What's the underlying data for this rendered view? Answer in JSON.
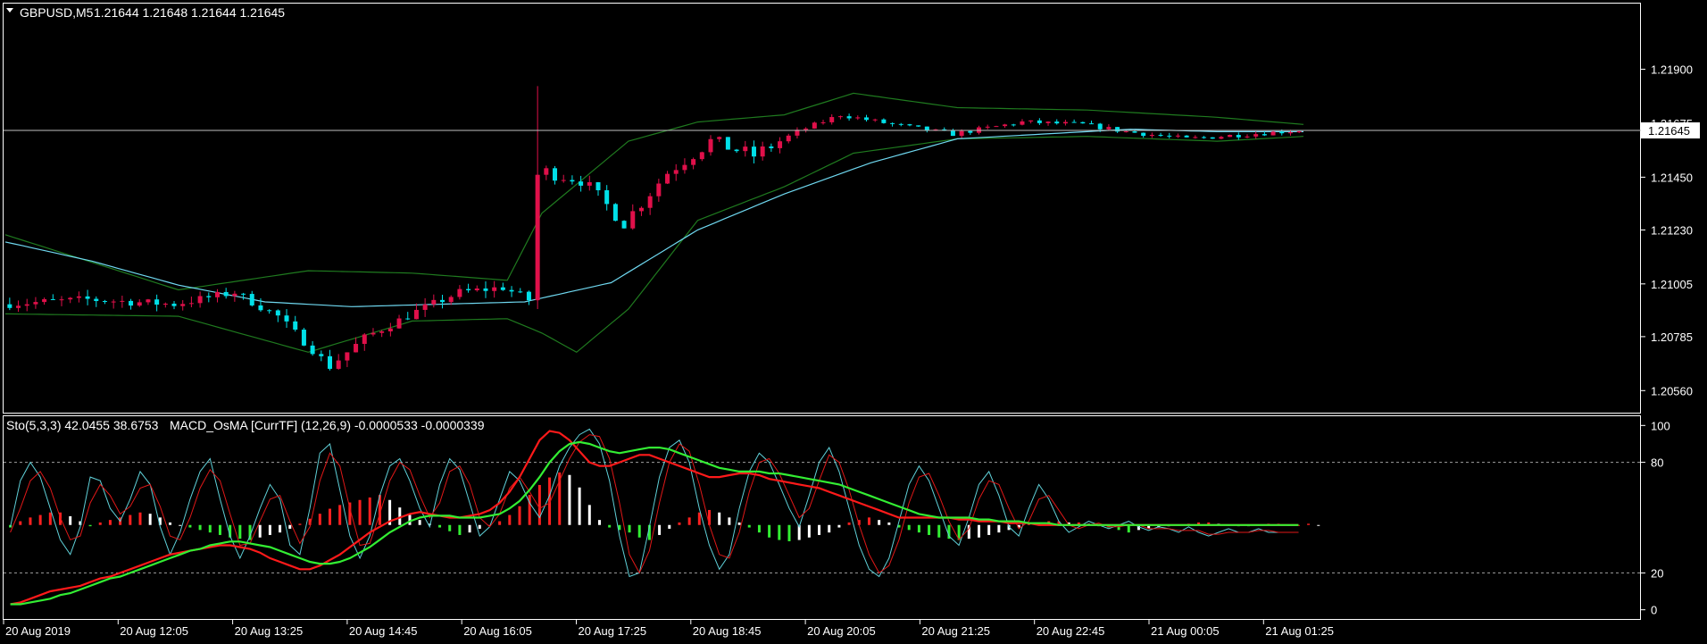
{
  "header": {
    "symbol": "GBPUSD,M5",
    "quote": "1.21644 1.21648 1.21644 1.21645",
    "dropdown_icon": "triangle-down-icon"
  },
  "indicator_header": {
    "stochastic": "Sto(5,3,3) 42.0455 38.6753",
    "macd": "MACD_OsMA [CurrTF] (12,26,9) -0.0000533 -0.0000339"
  },
  "colors": {
    "background": "#000000",
    "border": "#ffffff",
    "bull_candle": "#00e0e8",
    "bear_candle": "#e0104a",
    "bollinger": "#1f7a1f",
    "moving_average": "#6fd8f0",
    "price_line": "#c0c0c0",
    "price_label_bg": "#ffffff",
    "stoch_main": "#5fd0d8",
    "stoch_signal": "#e01818",
    "macd_main": "#ff1a1a",
    "macd_signal": "#33ee33",
    "hist_up": "#ff2020",
    "hist_up_fade": "#ffffff",
    "hist_down": "#33ee33",
    "hist_down_fade": "#ffffff",
    "level_line": "#a0a0a0"
  },
  "chart_data": [
    {
      "type": "candlestick",
      "price_axis": {
        "ticks": [
          "1.21900",
          "1.21675",
          "1.21450",
          "1.21230",
          "1.21005",
          "1.20785",
          "1.20560"
        ],
        "tick_values": [
          1.219,
          1.21675,
          1.2145,
          1.2123,
          1.21005,
          1.20785,
          1.2056
        ],
        "ylim": [
          1.20468,
          1.22174
        ],
        "current_price": "1.21645",
        "current_value": 1.21645
      },
      "time_axis": {
        "labels": [
          "20 Aug 2019",
          "20 Aug 12:05",
          "20 Aug 13:25",
          "20 Aug 14:45",
          "20 Aug 16:05",
          "20 Aug 17:25",
          "20 Aug 18:45",
          "20 Aug 20:05",
          "20 Aug 21:25",
          "20 Aug 22:45",
          "21 Aug 00:05",
          "21 Aug 01:25"
        ]
      },
      "bar_count": 200,
      "price_path": [
        [
          0,
          1.2092
        ],
        [
          10,
          1.2094
        ],
        [
          20,
          1.2092
        ],
        [
          27,
          1.2097
        ],
        [
          32,
          1.2087
        ],
        [
          38,
          1.2066
        ],
        [
          42,
          1.2078
        ],
        [
          48,
          1.2089
        ],
        [
          53,
          1.2097
        ],
        [
          58,
          1.2099
        ],
        [
          61,
          1.2094
        ],
        [
          62,
          1.2148
        ],
        [
          67,
          1.2144
        ],
        [
          72,
          1.2126
        ],
        [
          77,
          1.2147
        ],
        [
          82,
          1.216
        ],
        [
          87,
          1.2154
        ],
        [
          92,
          1.2164
        ],
        [
          97,
          1.2171
        ],
        [
          103,
          1.2167
        ],
        [
          110,
          1.2163
        ],
        [
          118,
          1.2168
        ],
        [
          125,
          1.2167
        ],
        [
          130,
          1.2164
        ],
        [
          137,
          1.2161
        ],
        [
          150,
          1.21645
        ]
      ],
      "series": [
        {
          "name": "Bollinger upper",
          "points": [
            [
              0,
              1.2121
            ],
            [
              20,
              1.2098
            ],
            [
              35,
              1.2106
            ],
            [
              47,
              1.2105
            ],
            [
              58,
              1.2102
            ],
            [
              62,
              1.213
            ],
            [
              72,
              1.216
            ],
            [
              80,
              1.2168
            ],
            [
              90,
              1.2171
            ],
            [
              98,
              1.218
            ],
            [
              110,
              1.2174
            ],
            [
              125,
              1.2173
            ],
            [
              140,
              1.217
            ],
            [
              150,
              1.2167
            ]
          ]
        },
        {
          "name": "Bollinger lower",
          "points": [
            [
              0,
              1.2088
            ],
            [
              20,
              1.2087
            ],
            [
              35,
              1.2072
            ],
            [
              47,
              1.2085
            ],
            [
              58,
              1.2086
            ],
            [
              62,
              1.208
            ],
            [
              66,
              1.2072
            ],
            [
              72,
              1.209
            ],
            [
              80,
              1.2127
            ],
            [
              90,
              1.2141
            ],
            [
              98,
              1.2155
            ],
            [
              110,
              1.2161
            ],
            [
              125,
              1.2162
            ],
            [
              140,
              1.216
            ],
            [
              150,
              1.2162
            ]
          ]
        },
        {
          "name": "Moving average",
          "points": [
            [
              0,
              1.2118
            ],
            [
              10,
              1.211
            ],
            [
              20,
              1.21
            ],
            [
              30,
              1.2093
            ],
            [
              40,
              1.2091
            ],
            [
              50,
              1.2092
            ],
            [
              60,
              1.2093
            ],
            [
              70,
              1.2101
            ],
            [
              80,
              1.2123
            ],
            [
              90,
              1.2138
            ],
            [
              100,
              1.2151
            ],
            [
              110,
              1.2161
            ],
            [
              120,
              1.2163
            ],
            [
              130,
              1.2165
            ],
            [
              140,
              1.2164
            ],
            [
              150,
              1.2164
            ]
          ]
        }
      ]
    },
    {
      "type": "line",
      "title": "Sto(5,3,3) 42.0455 38.6753",
      "levels": [
        {
          "label": "100",
          "value": 100
        },
        {
          "label": "80",
          "value": 80
        },
        {
          "label": "20",
          "value": 20
        },
        {
          "label": "0",
          "value": 0
        }
      ],
      "ylim": [
        -5,
        105
      ],
      "series": [
        {
          "name": "Sto main",
          "values": [
            45,
            70,
            80,
            72,
            55,
            38,
            30,
            45,
            72,
            70,
            55,
            48,
            60,
            75,
            68,
            45,
            30,
            42,
            60,
            75,
            82,
            60,
            40,
            28,
            40,
            55,
            68,
            60,
            35,
            30,
            55,
            85,
            90,
            65,
            40,
            28,
            40,
            62,
            78,
            82,
            70,
            55,
            45,
            68,
            82,
            76,
            58,
            40,
            45,
            60,
            75,
            70,
            58,
            50,
            62,
            78,
            88,
            95,
            98,
            90,
            70,
            40,
            18,
            20,
            45,
            72,
            88,
            92,
            80,
            55,
            35,
            22,
            30,
            55,
            75,
            85,
            80,
            68,
            55,
            45,
            62,
            80,
            88,
            75,
            55,
            35,
            22,
            18,
            28,
            48,
            68,
            78,
            70,
            55,
            40,
            35,
            50,
            68,
            75,
            62,
            45,
            40,
            55,
            68,
            60,
            48,
            42,
            45,
            48,
            46,
            44,
            46,
            48,
            45,
            43,
            45,
            44,
            42,
            45,
            42,
            40,
            42,
            44,
            42,
            42,
            44,
            42,
            42,
            42,
            42
          ]
        },
        {
          "name": "Sto signal",
          "values": [
            42,
            55,
            70,
            75,
            66,
            50,
            38,
            40,
            58,
            68,
            62,
            52,
            56,
            66,
            68,
            56,
            40,
            38,
            50,
            66,
            76,
            70,
            52,
            35,
            36,
            48,
            60,
            62,
            48,
            36,
            45,
            70,
            85,
            78,
            55,
            35,
            36,
            52,
            70,
            80,
            76,
            62,
            50,
            58,
            75,
            78,
            68,
            50,
            45,
            52,
            66,
            72,
            64,
            55,
            58,
            70,
            82,
            91,
            95,
            94,
            82,
            58,
            30,
            20,
            32,
            58,
            80,
            90,
            86,
            68,
            46,
            30,
            28,
            42,
            64,
            80,
            82,
            74,
            62,
            50,
            55,
            70,
            84,
            80,
            65,
            46,
            30,
            20,
            24,
            38,
            58,
            72,
            74,
            62,
            48,
            38,
            44,
            60,
            70,
            68,
            55,
            44,
            48,
            60,
            62,
            54,
            46,
            44,
            46,
            47,
            45,
            45,
            46,
            46,
            44,
            44,
            44,
            43,
            43,
            43,
            41,
            41,
            42,
            42,
            42,
            43,
            43,
            42,
            42,
            42
          ]
        },
        {
          "name": "MACD main",
          "values": [
            3,
            4,
            6,
            8,
            10,
            11,
            12,
            13,
            15,
            17,
            18,
            20,
            22,
            24,
            26,
            28,
            30,
            31,
            32,
            33,
            34,
            35,
            35,
            34,
            33,
            31,
            28,
            26,
            24,
            22,
            22,
            24,
            27,
            30,
            34,
            38,
            42,
            45,
            48,
            50,
            52,
            53,
            52,
            51,
            50,
            50,
            51,
            52,
            54,
            58,
            64,
            72,
            82,
            92,
            97,
            96,
            92,
            86,
            80,
            78,
            78,
            80,
            82,
            84,
            84,
            82,
            80,
            78,
            76,
            74,
            72,
            72,
            73,
            74,
            74,
            73,
            71,
            70,
            69,
            68,
            67,
            66,
            64,
            62,
            60,
            58,
            56,
            54,
            52,
            50,
            50,
            50,
            50,
            50,
            50,
            49,
            49,
            48,
            48,
            48,
            47,
            47,
            47,
            46,
            46,
            46,
            46,
            46,
            46,
            46,
            46,
            46,
            46,
            46,
            46,
            46,
            46,
            46,
            46,
            46,
            46,
            46,
            46,
            46,
            46,
            46,
            46,
            46,
            46,
            46
          ]
        },
        {
          "name": "MACD signal",
          "values": [
            3,
            3,
            4,
            5,
            6,
            8,
            9,
            11,
            13,
            15,
            17,
            18,
            20,
            22,
            24,
            26,
            28,
            30,
            32,
            33,
            35,
            36,
            37,
            37,
            36,
            35,
            34,
            32,
            30,
            28,
            26,
            25,
            25,
            26,
            28,
            31,
            34,
            38,
            42,
            45,
            48,
            50,
            51,
            51,
            51,
            50,
            50,
            50,
            51,
            52,
            55,
            59,
            65,
            72,
            80,
            86,
            90,
            91,
            90,
            88,
            86,
            85,
            86,
            87,
            88,
            88,
            87,
            85,
            83,
            81,
            79,
            77,
            76,
            75,
            75,
            75,
            74,
            74,
            73,
            72,
            71,
            70,
            69,
            68,
            66,
            64,
            62,
            60,
            58,
            56,
            54,
            52,
            51,
            50,
            50,
            50,
            50,
            49,
            49,
            48,
            48,
            48,
            47,
            47,
            47,
            46,
            46,
            46,
            46,
            46,
            46,
            46,
            46,
            46,
            46,
            46,
            46,
            46,
            46,
            46,
            46,
            46,
            46,
            46,
            46,
            46,
            46,
            46,
            46,
            46
          ]
        }
      ],
      "histogram": [
        -2,
        3,
        6,
        8,
        10,
        10,
        7,
        3,
        -1,
        2,
        4,
        6,
        8,
        10,
        9,
        6,
        2,
        0,
        -2,
        -4,
        -6,
        -8,
        -10,
        -11,
        -12,
        -10,
        -8,
        -6,
        -3,
        1,
        5,
        9,
        13,
        16,
        18,
        20,
        22,
        24,
        20,
        14,
        8,
        4,
        1,
        -2,
        -5,
        -8,
        -6,
        -3,
        0,
        3,
        8,
        15,
        24,
        32,
        38,
        42,
        40,
        30,
        16,
        4,
        -2,
        -4,
        -6,
        -10,
        -12,
        -8,
        -3,
        2,
        6,
        10,
        12,
        10,
        6,
        2,
        -2,
        -6,
        -10,
        -12,
        -13,
        -12,
        -10,
        -8,
        -6,
        -2,
        2,
        4,
        6,
        4,
        2,
        -2,
        -4,
        -6,
        -8,
        -10,
        -11,
        -12,
        -11,
        -10,
        -8,
        -6,
        -4,
        -2,
        1,
        2,
        3,
        3,
        2,
        2,
        1,
        -1,
        -2,
        -4,
        -6,
        -4,
        -3,
        -2,
        -1,
        0,
        1,
        2,
        2,
        1,
        0,
        -1,
        -1,
        0,
        1,
        1,
        0,
        0,
        1,
        0
      ]
    }
  ]
}
